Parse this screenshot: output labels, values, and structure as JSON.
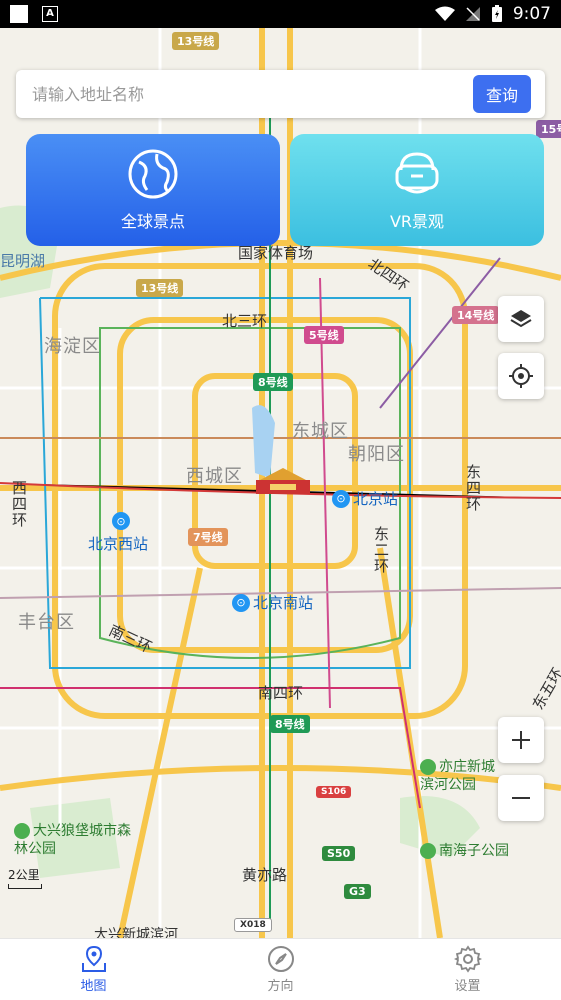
{
  "status_bar": {
    "time": "9:07"
  },
  "search": {
    "placeholder": "请输入地址名称",
    "button_label": "查询"
  },
  "cards": {
    "global_label": "全球景点",
    "vr_label": "VR景观"
  },
  "map": {
    "districts": [
      "海淀区",
      "东城区",
      "西城区",
      "朝阳区",
      "丰台区"
    ],
    "roads": [
      "北三环",
      "北四环",
      "西四环",
      "东四环",
      "东二环",
      "南三环",
      "南四环",
      "黄亦路",
      "东五环"
    ],
    "lines": [
      "13号线",
      "5号线",
      "8号线",
      "14号线",
      "7号线",
      "15号"
    ],
    "stations": [
      "北京站",
      "北京西站",
      "北京南站",
      "国家体育场"
    ],
    "pois": [
      "昆明湖",
      "亦庄新城滨河公园",
      "大兴狼垡城市森林公园",
      "南海子公园",
      "大兴新城滨河"
    ],
    "shields": [
      "S50",
      "G3",
      "S106",
      "X018"
    ],
    "scale": "2公里"
  },
  "nav": {
    "map": "地图",
    "direction": "方向",
    "settings": "设置",
    "active": "map"
  }
}
